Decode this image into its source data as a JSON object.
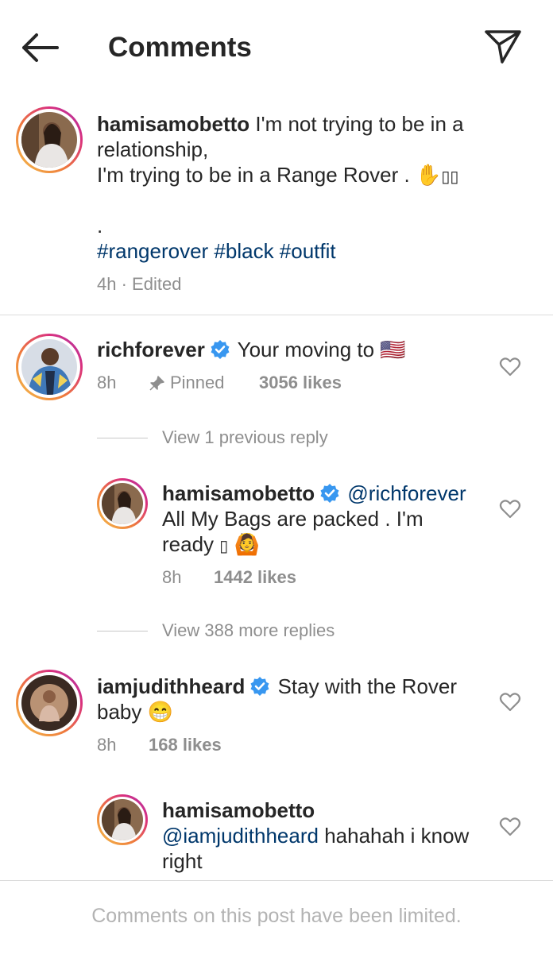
{
  "header": {
    "title": "Comments",
    "back_icon": "arrow-left-icon",
    "share_icon": "paper-plane-icon"
  },
  "caption": {
    "username": "hamisamobetto",
    "line1": "I'm not trying to be in a",
    "line2": "relationship,",
    "line3": "I'm trying to be in a Range Rover .",
    "line3_emoji": "✋",
    "line3_missing": "▯▯",
    "dot": ".",
    "hashtags": "#rangerover #black #outfit",
    "time": "4h",
    "edited": "· Edited"
  },
  "comments": [
    {
      "username": "richforever",
      "text": "Your moving to",
      "flag": "🇺🇸",
      "time": "8h",
      "pinned": "Pinned",
      "likes": "3056 likes",
      "view_replies": "View 1 previous reply",
      "reply": {
        "username": "hamisamobetto",
        "mention": "@richforever",
        "line1": "All My Bags are packed . I'm",
        "line2": "ready",
        "missing": "▯",
        "emoji": "🙆",
        "time": "8h",
        "likes": "1442 likes"
      },
      "more_replies": "View 388 more replies"
    },
    {
      "username": "iamjudithheard",
      "text": "Stay with the Rover",
      "line2": "baby",
      "emoji": "😁",
      "time": "8h",
      "likes": "168 likes",
      "reply": {
        "username": "hamisamobetto",
        "mention": "@iamjudithheard",
        "text": "hahahah i know",
        "line2": "right"
      }
    }
  ],
  "footer": {
    "text": "Comments on this post have been limited."
  },
  "colors": {
    "link": "#00376b",
    "muted": "#8e8e8e",
    "verified": "#3897f0"
  }
}
